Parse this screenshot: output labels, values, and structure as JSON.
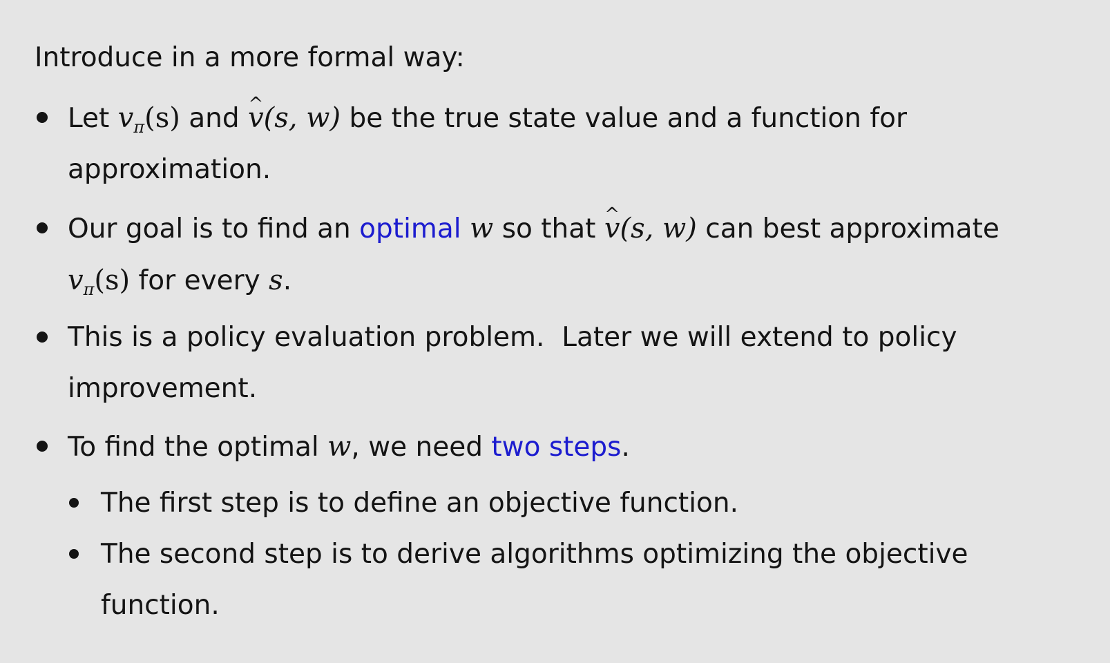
{
  "intro": "Introduce in a more formal way:",
  "bullets": {
    "b1": {
      "t1": "Let",
      "m_v": "v",
      "m_pi": "π",
      "m_s_paren": "(s)",
      "t2": "and",
      "m_vhat": "v",
      "m_sw": "(s, w)",
      "t3": "be the true state value and a function for",
      "t4": "approximation."
    },
    "b2": {
      "t1": "Our goal is to find an",
      "hl": "optimal",
      "m_w": "w",
      "t2": "so that",
      "m_vhat": "v",
      "m_sw": "(s, w)",
      "t3": "can best approximate",
      "m_v": "v",
      "m_pi": "π",
      "m_s_paren": "(s)",
      "t4": "for every",
      "m_s": "s",
      "t5": "."
    },
    "b3": {
      "t1": "This is a policy evaluation problem.  Later we will extend to policy",
      "t2": "improvement."
    },
    "b4": {
      "t1": "To find the optimal",
      "m_w": "w",
      "t2": ", we need",
      "hl": "two steps",
      "t3": "."
    }
  },
  "sub_bullets": {
    "s1": "The first step is to define an objective function.",
    "s2_line1": "The second step is to derive algorithms optimizing the objective",
    "s2_line2": "function."
  },
  "colors": {
    "background": "#e5e5e5",
    "text": "#141414",
    "highlight": "#1c1ccf"
  }
}
